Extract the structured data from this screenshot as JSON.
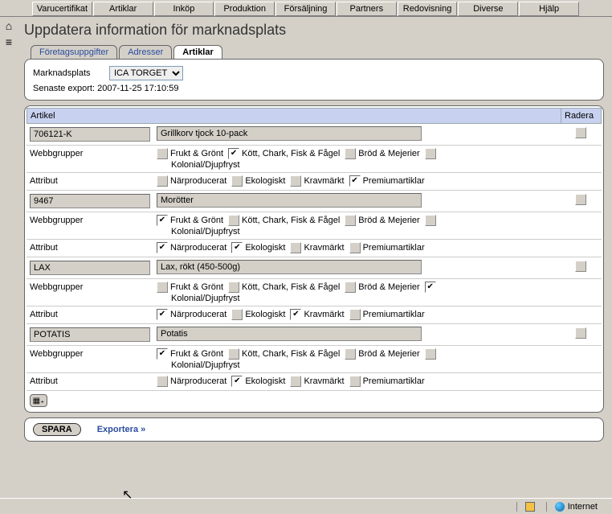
{
  "menu": [
    "Varucertifikat",
    "Artiklar",
    "Inköp",
    "Produktion",
    "Försäljning",
    "Partners",
    "Redovisning",
    "Diverse",
    "Hjälp"
  ],
  "pageTitle": "Uppdatera information för marknadsplats",
  "tabs": {
    "t0": "Företagsuppgifter",
    "t1": "Adresser",
    "t2": "Artiklar"
  },
  "head": {
    "marketLabel": "Marknadsplats",
    "marketValue": "ICA TORGET",
    "exportLabel": "Senaste export: 2007-11-25 17:10:59"
  },
  "gridHeader": {
    "article": "Artikel",
    "delete": "Radera"
  },
  "labels": {
    "webgroups": "Webbgrupper",
    "attributes": "Attribut"
  },
  "webgroupNames": {
    "g0": "Frukt & Grönt",
    "g1": "Kött, Chark, Fisk & Fågel",
    "g2": "Bröd & Mejerier",
    "g3": "Kolonial/Djupfryst"
  },
  "attrNames": {
    "a0": "Närproducerat",
    "a1": "Ekologiskt",
    "a2": "Kravmärkt",
    "a3": "Premiumartiklar"
  },
  "rows": [
    {
      "code": "706121-K",
      "name": "Grillkorv tjock 10-pack",
      "wg": [
        false,
        true,
        false,
        false
      ],
      "attr": [
        false,
        false,
        false,
        true
      ]
    },
    {
      "code": "9467",
      "name": "Morötter",
      "wg": [
        true,
        false,
        false,
        false
      ],
      "attr": [
        true,
        true,
        false,
        false
      ]
    },
    {
      "code": "LAX",
      "name": "Lax, rökt (450-500g)",
      "wg": [
        false,
        false,
        false,
        true
      ],
      "attr": [
        true,
        false,
        true,
        false
      ]
    },
    {
      "code": "POTATIS",
      "name": "Potatis",
      "wg": [
        true,
        false,
        false,
        false
      ],
      "attr": [
        false,
        true,
        false,
        false
      ]
    }
  ],
  "footer": {
    "save": "SPARA",
    "export": "Exportera »"
  },
  "status": {
    "internet": "Internet"
  }
}
